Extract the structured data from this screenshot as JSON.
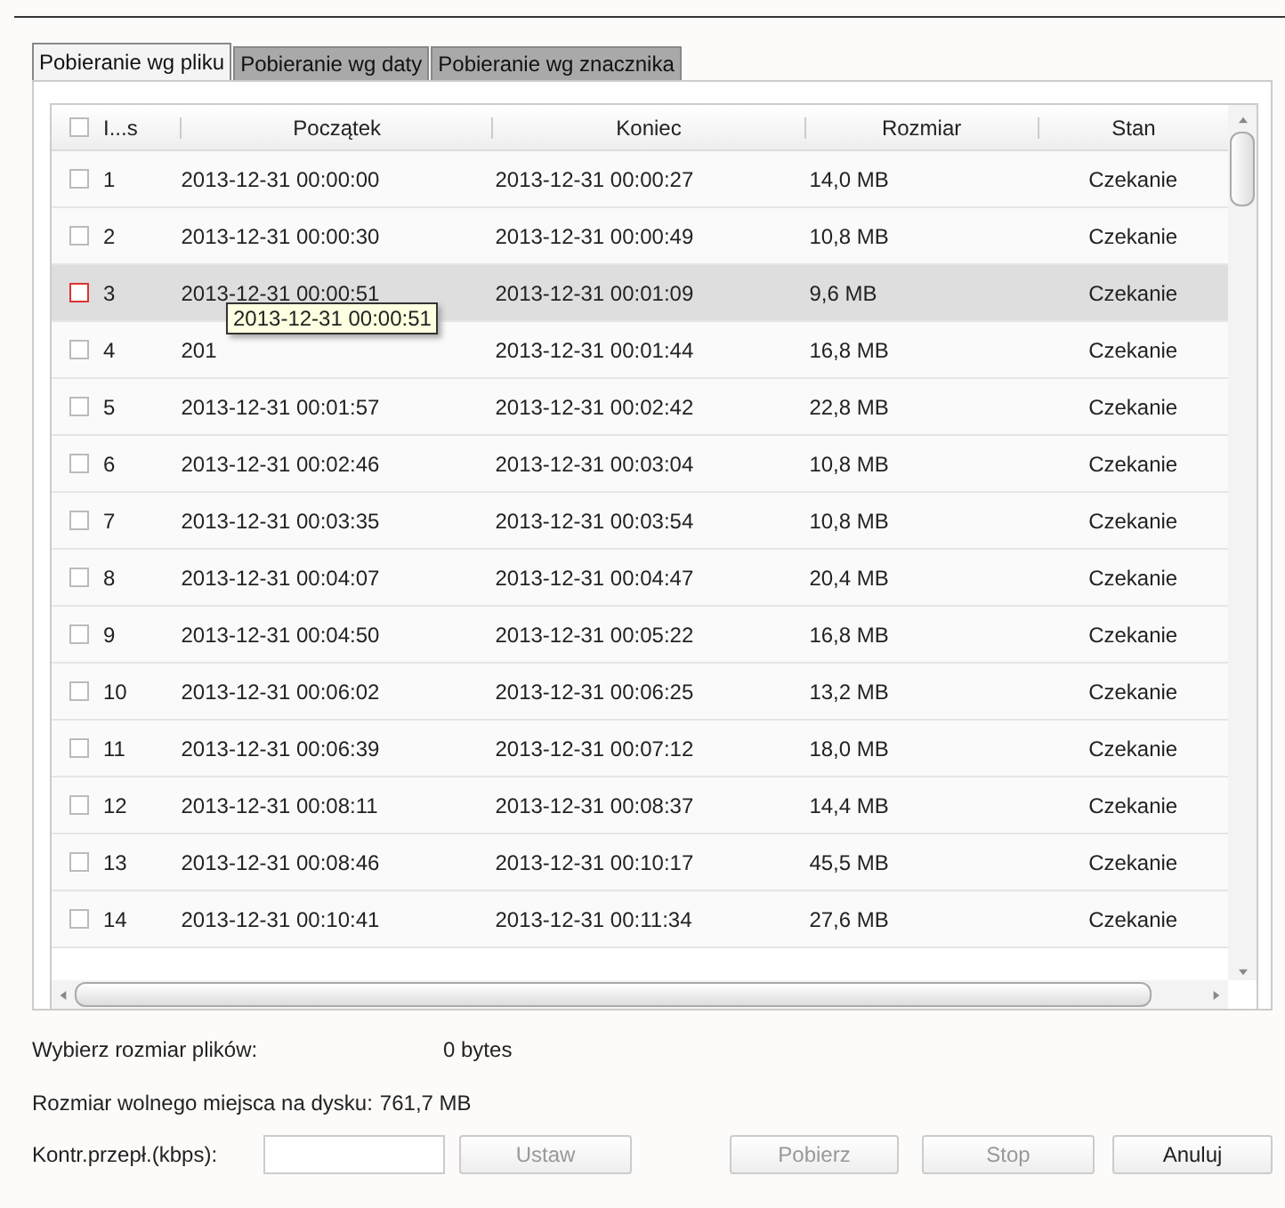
{
  "tabs": [
    {
      "label": "Pobieranie wg pliku",
      "selected": true
    },
    {
      "label": "Pobieranie wg daty",
      "selected": false
    },
    {
      "label": "Pobieranie wg znacznika",
      "selected": false
    }
  ],
  "table": {
    "columns": [
      "I...s",
      "Początek",
      "Koniec",
      "Rozmiar",
      "Stan"
    ],
    "header_checked": false,
    "rows": [
      {
        "index": "1",
        "start": "2013-12-31 00:00:00",
        "end": "2013-12-31 00:00:27",
        "size": "14,0 MB",
        "status": "Czekanie",
        "selected": false
      },
      {
        "index": "2",
        "start": "2013-12-31 00:00:30",
        "end": "2013-12-31 00:00:49",
        "size": "10,8 MB",
        "status": "Czekanie",
        "selected": false
      },
      {
        "index": "3",
        "start": "2013-12-31 00:00:51",
        "end": "2013-12-31 00:01:09",
        "size": "9,6 MB",
        "status": "Czekanie",
        "selected": true
      },
      {
        "index": "4",
        "start": "201",
        "end": "2013-12-31 00:01:44",
        "size": "16,8 MB",
        "status": "Czekanie",
        "selected": false
      },
      {
        "index": "5",
        "start": "2013-12-31 00:01:57",
        "end": "2013-12-31 00:02:42",
        "size": "22,8 MB",
        "status": "Czekanie",
        "selected": false
      },
      {
        "index": "6",
        "start": "2013-12-31 00:02:46",
        "end": "2013-12-31 00:03:04",
        "size": "10,8 MB",
        "status": "Czekanie",
        "selected": false
      },
      {
        "index": "7",
        "start": "2013-12-31 00:03:35",
        "end": "2013-12-31 00:03:54",
        "size": "10,8 MB",
        "status": "Czekanie",
        "selected": false
      },
      {
        "index": "8",
        "start": "2013-12-31 00:04:07",
        "end": "2013-12-31 00:04:47",
        "size": "20,4 MB",
        "status": "Czekanie",
        "selected": false
      },
      {
        "index": "9",
        "start": "2013-12-31 00:04:50",
        "end": "2013-12-31 00:05:22",
        "size": "16,8 MB",
        "status": "Czekanie",
        "selected": false
      },
      {
        "index": "10",
        "start": "2013-12-31 00:06:02",
        "end": "2013-12-31 00:06:25",
        "size": "13,2 MB",
        "status": "Czekanie",
        "selected": false
      },
      {
        "index": "11",
        "start": "2013-12-31 00:06:39",
        "end": "2013-12-31 00:07:12",
        "size": "18,0 MB",
        "status": "Czekanie",
        "selected": false
      },
      {
        "index": "12",
        "start": "2013-12-31 00:08:11",
        "end": "2013-12-31 00:08:37",
        "size": "14,4 MB",
        "status": "Czekanie",
        "selected": false
      },
      {
        "index": "13",
        "start": "2013-12-31 00:08:46",
        "end": "2013-12-31 00:10:17",
        "size": "45,5 MB",
        "status": "Czekanie",
        "selected": false
      },
      {
        "index": "14",
        "start": "2013-12-31 00:10:41",
        "end": "2013-12-31 00:11:34",
        "size": "27,6 MB",
        "status": "Czekanie",
        "selected": false
      }
    ]
  },
  "tooltip": "2013-12-31 00:00:51",
  "summary": [
    {
      "label": "Wybierz rozmiar plików:",
      "value": "0 bytes"
    },
    {
      "label": "Rozmiar wolnego miejsca na dysku:",
      "value": "761,7 MB"
    }
  ],
  "rate_label": "Kontr.przepł.(kbps):",
  "buttons": [
    {
      "label": "Ustaw",
      "disabled": true
    },
    {
      "label": "Pobierz",
      "disabled": true
    },
    {
      "label": "Stop",
      "disabled": true
    },
    {
      "label": "Anuluj",
      "disabled": false
    }
  ]
}
